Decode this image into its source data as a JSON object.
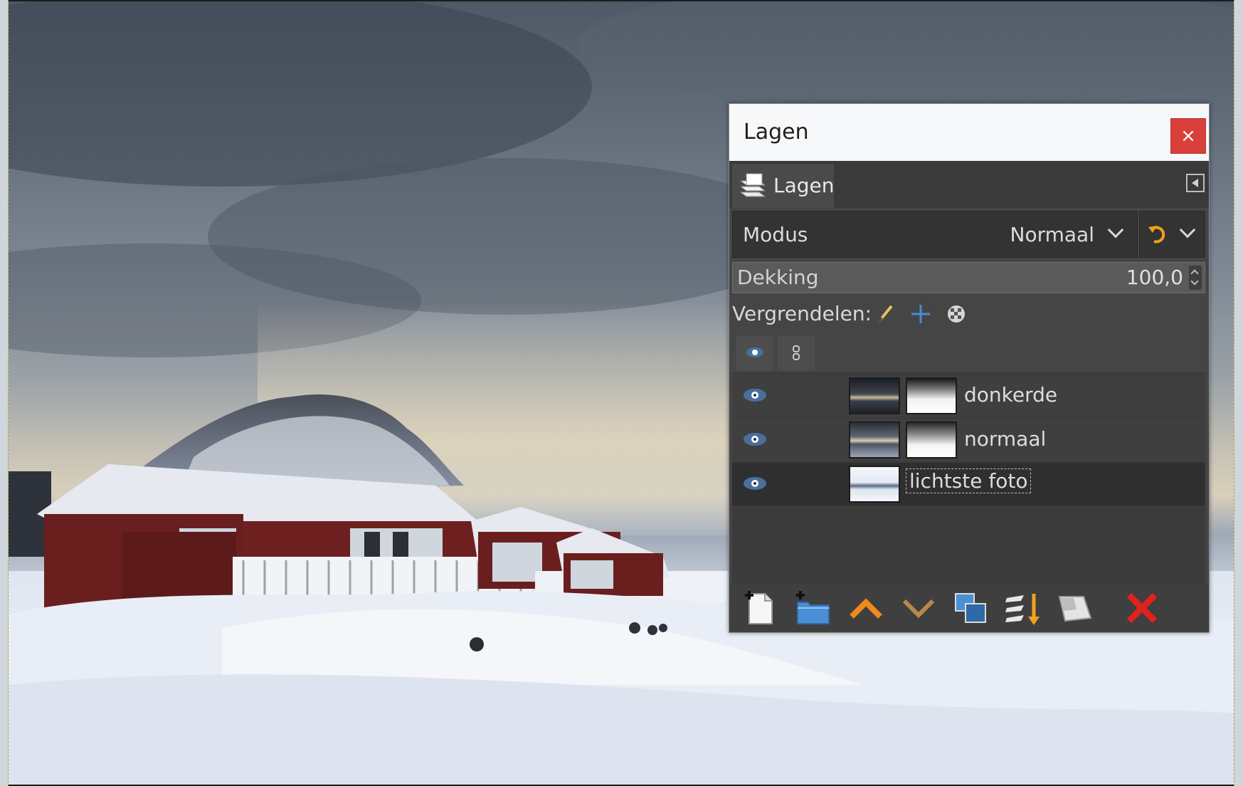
{
  "dialog": {
    "title": "Lagen",
    "close_label": "×",
    "tab_label": "Lagen",
    "mode_label": "Modus",
    "mode_value": "Normaal",
    "opacity_label": "Dekking",
    "opacity_value": "100,0",
    "lock_label": "Vergrendelen:",
    "layers": [
      {
        "name": "donkerde",
        "visible": true,
        "has_mask": true
      },
      {
        "name": "normaal",
        "visible": true,
        "has_mask": true
      },
      {
        "name": "lichtste foto",
        "visible": true,
        "has_mask": false,
        "selected": true
      }
    ],
    "toolbar_icons": [
      "new-layer-icon",
      "new-layer-group-icon",
      "raise-layer-icon",
      "lower-layer-icon",
      "duplicate-layer-icon",
      "anchor-merge-layer-icon",
      "add-mask-icon",
      "delete-layer-icon"
    ]
  },
  "colors": {
    "close_button": "#d9403b",
    "raise_arrow": "#f08a1c",
    "lower_arrow": "#b68a4c",
    "delete": "#e0231f",
    "group_folder": "#4a8fd6"
  }
}
